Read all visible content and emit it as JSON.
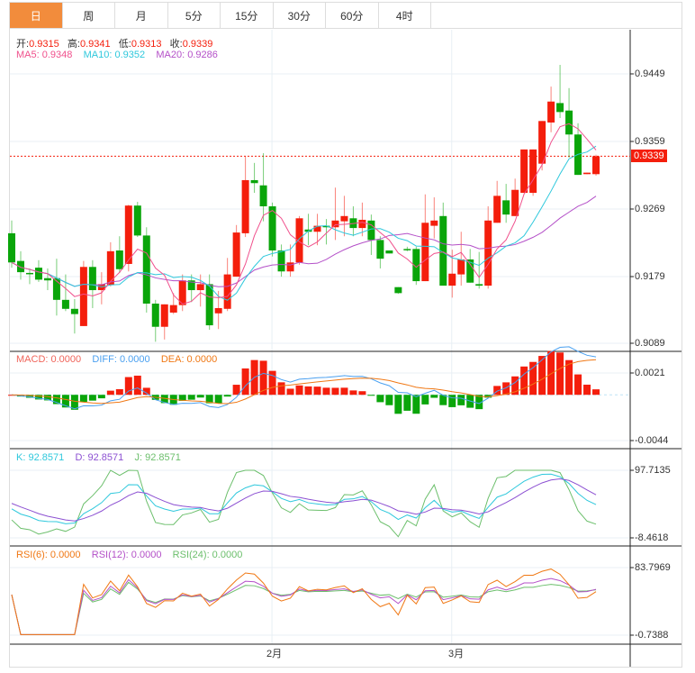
{
  "tabs": [
    {
      "label": "日",
      "active": true
    },
    {
      "label": "周",
      "active": false
    },
    {
      "label": "月",
      "active": false
    },
    {
      "label": "5分",
      "active": false
    },
    {
      "label": "15分",
      "active": false
    },
    {
      "label": "30分",
      "active": false
    },
    {
      "label": "60分",
      "active": false
    },
    {
      "label": "4时",
      "active": false
    }
  ],
  "ohlc_legend": {
    "open_label": "开:",
    "open": "0.9315",
    "high_label": "高:",
    "high": "0.9341",
    "low_label": "低:",
    "low": "0.9313",
    "close_label": "收:",
    "close": "0.9339"
  },
  "ma_legend": {
    "ma5": "MA5: 0.9348",
    "ma10": "MA10: 0.9352",
    "ma20": "MA20: 0.9286"
  },
  "macd_legend": {
    "macd": "MACD: 0.0000",
    "diff": "DIFF: 0.0000",
    "dea": "DEA: 0.0000"
  },
  "kdj_legend": {
    "k": "K: 92.8571",
    "d": "D: 92.8571",
    "j": "J: 92.8571"
  },
  "rsi_legend": {
    "rsi6": "RSI(6): 0.0000",
    "rsi12": "RSI(12): 0.0000",
    "rsi24": "RSI(24): 0.0000"
  },
  "colors": {
    "up": "#f41e0c",
    "down": "#0aa50a",
    "ma5": "#f0508c",
    "ma10": "#2ec8dc",
    "ma20": "#b450c8",
    "diff": "#4aa0f0",
    "dea": "#f07814",
    "k": "#2ec8dc",
    "d": "#8c50d2",
    "j": "#6cbf6c",
    "rsi6": "#f07814",
    "rsi12": "#b450c8",
    "rsi24": "#6cbf6c",
    "tab_active": "#f28c3c"
  },
  "chart_data": {
    "type": "candlestick",
    "current_price": "0.9339",
    "price_axis": {
      "ticks": [
        "0.9449",
        "0.9359",
        "0.9269",
        "0.9179",
        "0.9089"
      ],
      "range": [
        0.9089,
        0.9449
      ]
    },
    "macd_axis": {
      "ticks": [
        "0.0021",
        "-0.0044"
      ],
      "range": [
        -0.0044,
        0.0021
      ]
    },
    "kdj_axis": {
      "ticks": [
        "97.7135",
        "-8.4618"
      ],
      "range": [
        -8.4618,
        97.7135
      ]
    },
    "rsi_axis": {
      "ticks": [
        "83.7969",
        "-0.7388"
      ],
      "range": [
        -0.7388,
        83.7969
      ]
    },
    "x_labels": [
      {
        "label": "2月",
        "index": 29
      },
      {
        "label": "3月",
        "index": 49
      }
    ],
    "candles": [
      [
        0.9236,
        0.9197,
        0.9253,
        0.919
      ],
      [
        0.9199,
        0.9184,
        0.9212,
        0.9174
      ],
      [
        0.9183,
        0.9182,
        0.9189,
        0.9168
      ],
      [
        0.919,
        0.9174,
        0.92,
        0.9171
      ],
      [
        0.9176,
        0.9173,
        0.9189,
        0.916
      ],
      [
        0.9176,
        0.9147,
        0.9202,
        0.9126
      ],
      [
        0.9147,
        0.9135,
        0.9181,
        0.9132
      ],
      [
        0.9135,
        0.9128,
        0.9148,
        0.9102
      ],
      [
        0.9112,
        0.9191,
        0.9199,
        0.9112
      ],
      [
        0.9191,
        0.916,
        0.92,
        0.9136
      ],
      [
        0.916,
        0.9168,
        0.9184,
        0.9141
      ],
      [
        0.9167,
        0.9212,
        0.9224,
        0.9165
      ],
      [
        0.9213,
        0.9188,
        0.9232,
        0.9183
      ],
      [
        0.9195,
        0.9273,
        0.9274,
        0.9185
      ],
      [
        0.9273,
        0.9233,
        0.9278,
        0.9231
      ],
      [
        0.9233,
        0.9142,
        0.9244,
        0.913
      ],
      [
        0.9142,
        0.9111,
        0.9147,
        0.9091
      ],
      [
        0.9111,
        0.9141,
        0.9141,
        0.9094
      ],
      [
        0.913,
        0.914,
        0.9156,
        0.9128
      ],
      [
        0.914,
        0.9173,
        0.9181,
        0.9132
      ],
      [
        0.9173,
        0.916,
        0.9181,
        0.9144
      ],
      [
        0.916,
        0.9168,
        0.9181,
        0.9138
      ],
      [
        0.9168,
        0.9113,
        0.9181,
        0.9107
      ],
      [
        0.9129,
        0.9136,
        0.9159,
        0.9108
      ],
      [
        0.9135,
        0.9181,
        0.9203,
        0.9132
      ],
      [
        0.9178,
        0.9237,
        0.9247,
        0.9178
      ],
      [
        0.9236,
        0.9307,
        0.9339,
        0.9231
      ],
      [
        0.9307,
        0.9303,
        0.933,
        0.929
      ],
      [
        0.93,
        0.9272,
        0.9343,
        0.9252
      ],
      [
        0.9272,
        0.9213,
        0.9277,
        0.9205
      ],
      [
        0.9213,
        0.9185,
        0.9221,
        0.9178
      ],
      [
        0.9185,
        0.9197,
        0.9221,
        0.9178
      ],
      [
        0.9197,
        0.9256,
        0.9259,
        0.9194
      ],
      [
        0.9241,
        0.9238,
        0.9262,
        0.922
      ],
      [
        0.9238,
        0.9246,
        0.9262,
        0.922
      ],
      [
        0.9246,
        0.9244,
        0.9255,
        0.9221
      ],
      [
        0.9244,
        0.9253,
        0.9297,
        0.9227
      ],
      [
        0.9252,
        0.9259,
        0.9286,
        0.9232
      ],
      [
        0.9256,
        0.9243,
        0.9272,
        0.9232
      ],
      [
        0.9243,
        0.9254,
        0.9277,
        0.9232
      ],
      [
        0.9253,
        0.9227,
        0.9261,
        0.9207
      ],
      [
        0.9227,
        0.9202,
        0.9232,
        0.9189
      ],
      [
        0.9213,
        0.9209,
        0.9213,
        0.9209
      ],
      [
        0.9164,
        0.9156,
        0.9164,
        0.9155
      ],
      [
        0.9215,
        0.9214,
        0.9218,
        0.9212
      ],
      [
        0.9215,
        0.9172,
        0.9218,
        0.9167
      ],
      [
        0.9172,
        0.925,
        0.9288,
        0.9172
      ],
      [
        0.9246,
        0.9253,
        0.9284,
        0.9229
      ],
      [
        0.9259,
        0.9166,
        0.9277,
        0.9166
      ],
      [
        0.9166,
        0.9182,
        0.9214,
        0.915
      ],
      [
        0.9181,
        0.9201,
        0.9238,
        0.9166
      ],
      [
        0.9201,
        0.917,
        0.9215,
        0.917
      ],
      [
        0.9168,
        0.9166,
        0.9211,
        0.9162
      ],
      [
        0.9166,
        0.9253,
        0.9272,
        0.9162
      ],
      [
        0.925,
        0.9286,
        0.9306,
        0.925
      ],
      [
        0.928,
        0.9261,
        0.9302,
        0.925
      ],
      [
        0.9259,
        0.9294,
        0.9309,
        0.9259
      ],
      [
        0.929,
        0.9348,
        0.9348,
        0.929
      ],
      [
        0.929,
        0.9348,
        0.9348,
        0.9286
      ],
      [
        0.9329,
        0.9386,
        0.9386,
        0.932
      ],
      [
        0.9384,
        0.9412,
        0.9432,
        0.9371
      ],
      [
        0.941,
        0.9398,
        0.9461,
        0.939
      ],
      [
        0.94,
        0.9368,
        0.943,
        0.9337
      ],
      [
        0.9368,
        0.9314,
        0.9383,
        0.9314
      ],
      [
        0.9315,
        0.9317,
        0.9317,
        0.9315
      ],
      [
        0.9315,
        0.9339,
        0.9341,
        0.9313
      ]
    ]
  }
}
